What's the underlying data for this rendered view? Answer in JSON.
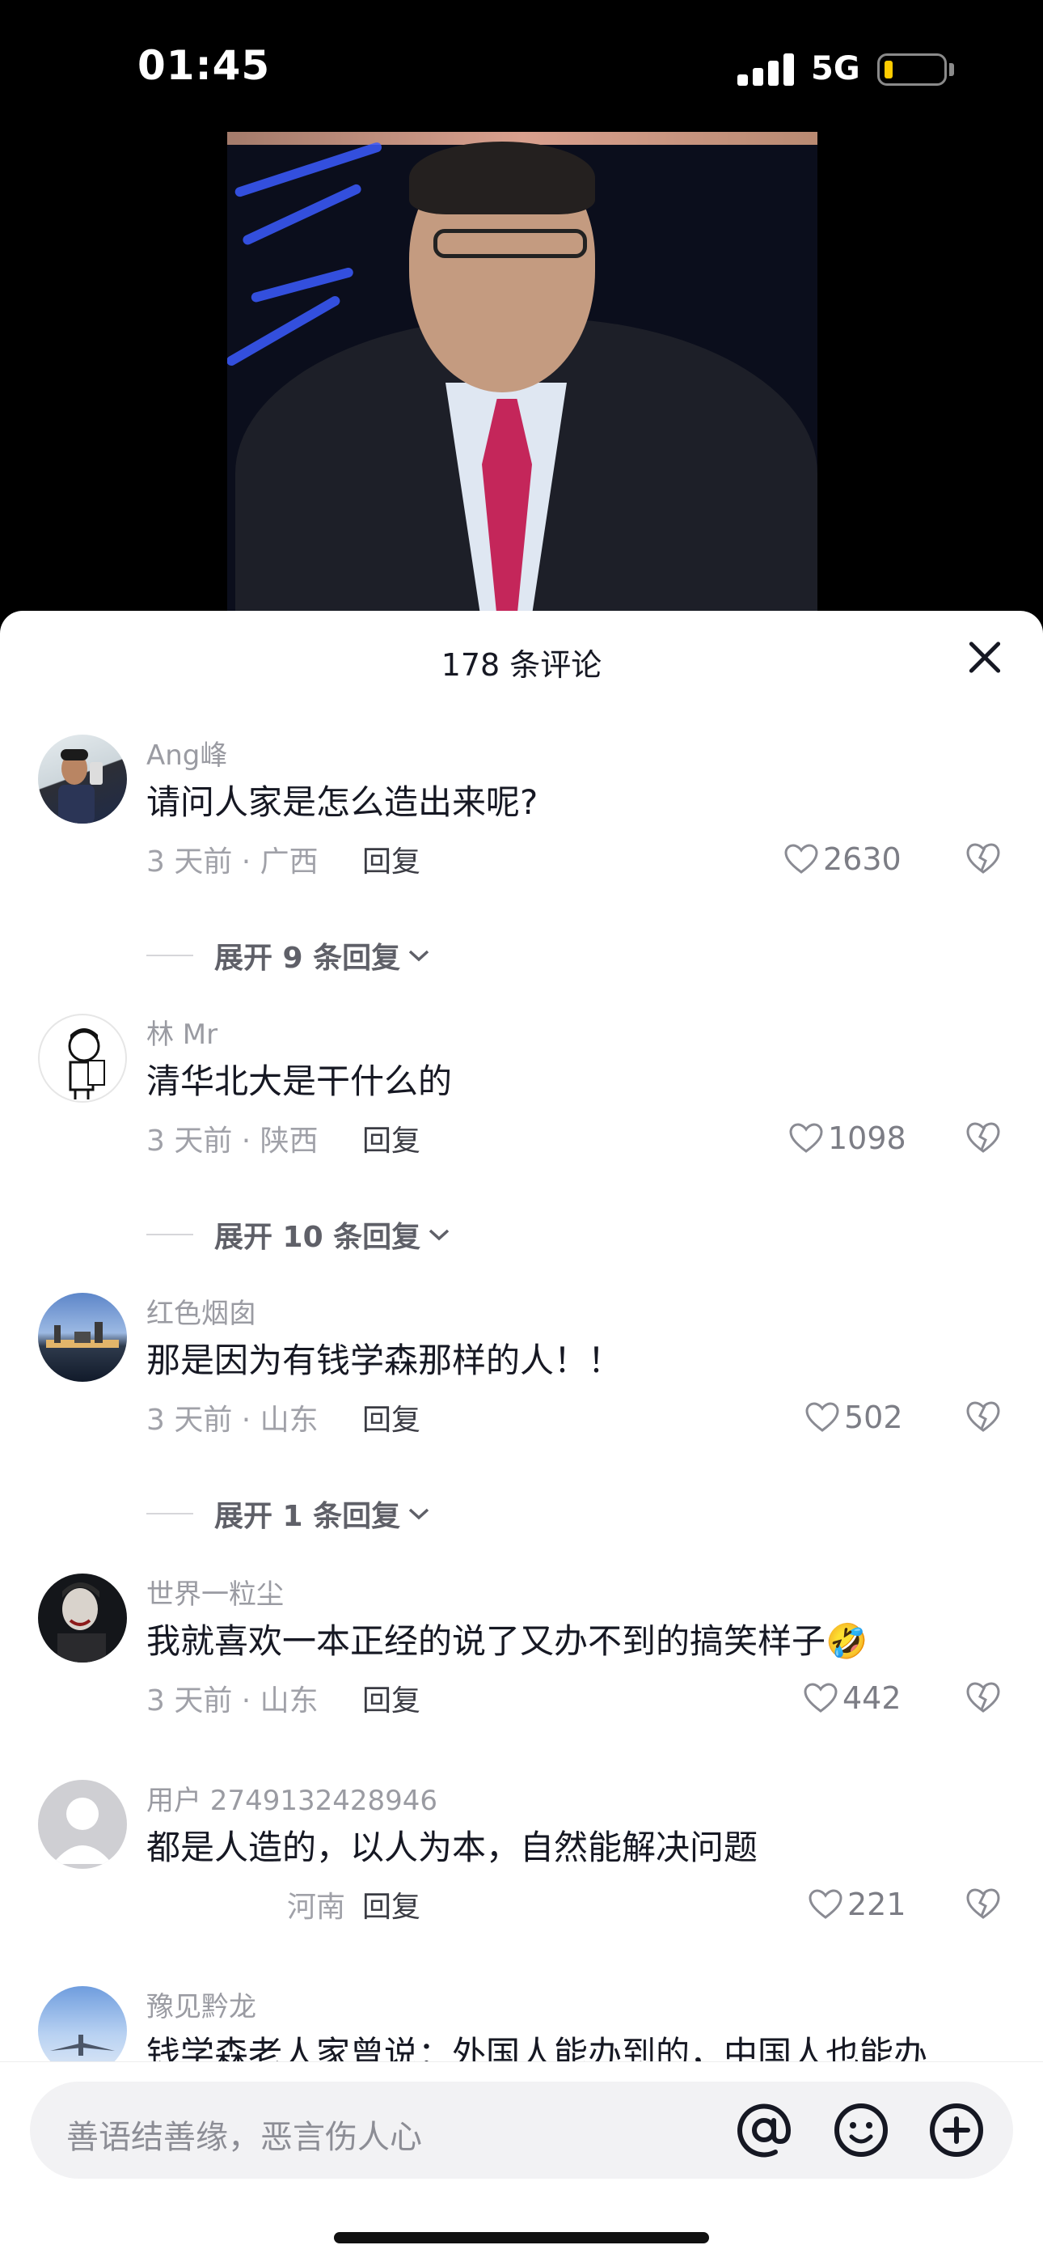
{
  "status_bar": {
    "time": "01:45",
    "network": "5G",
    "battery_color": "#ffcc00"
  },
  "comments_panel": {
    "title": "178 条评论",
    "comments": [
      {
        "username": "Ang峰",
        "text": "请问人家是怎么造出来呢?",
        "meta": "3 天前 · 广西",
        "reply": "回复",
        "likes": "2630",
        "expand": "展开 9 条回复"
      },
      {
        "username": "林 Mr",
        "text": "清华北大是干什么的",
        "meta": "3 天前 · 陕西",
        "reply": "回复",
        "likes": "1098",
        "expand": "展开 10 条回复"
      },
      {
        "username": "红色烟囱",
        "text": "那是因为有钱学森那样的人！！",
        "meta": "3 天前 · 山东",
        "reply": "回复",
        "likes": "502",
        "expand": "展开 1 条回复"
      },
      {
        "username": "世界一粒尘",
        "text": "我就喜欢一本正经的说了又办不到的搞笑样子🤣",
        "meta": "3 天前 · 山东",
        "reply": "回复",
        "likes": "442"
      },
      {
        "username": "用户 2749132428946",
        "text": "都是人造的，以人为本，自然能解决问题",
        "meta": "河南",
        "reply": "回复",
        "likes": "221"
      },
      {
        "username": "豫见黔龙",
        "text": "钱学森老人家曾说：外国人能办到的，中国人也能办"
      }
    ]
  },
  "input_bar": {
    "placeholder": "善语结善缘，恶言伤人心"
  },
  "icons": {
    "at": "at-icon",
    "emoji": "emoji-icon",
    "add": "add-icon",
    "close": "close-icon"
  }
}
